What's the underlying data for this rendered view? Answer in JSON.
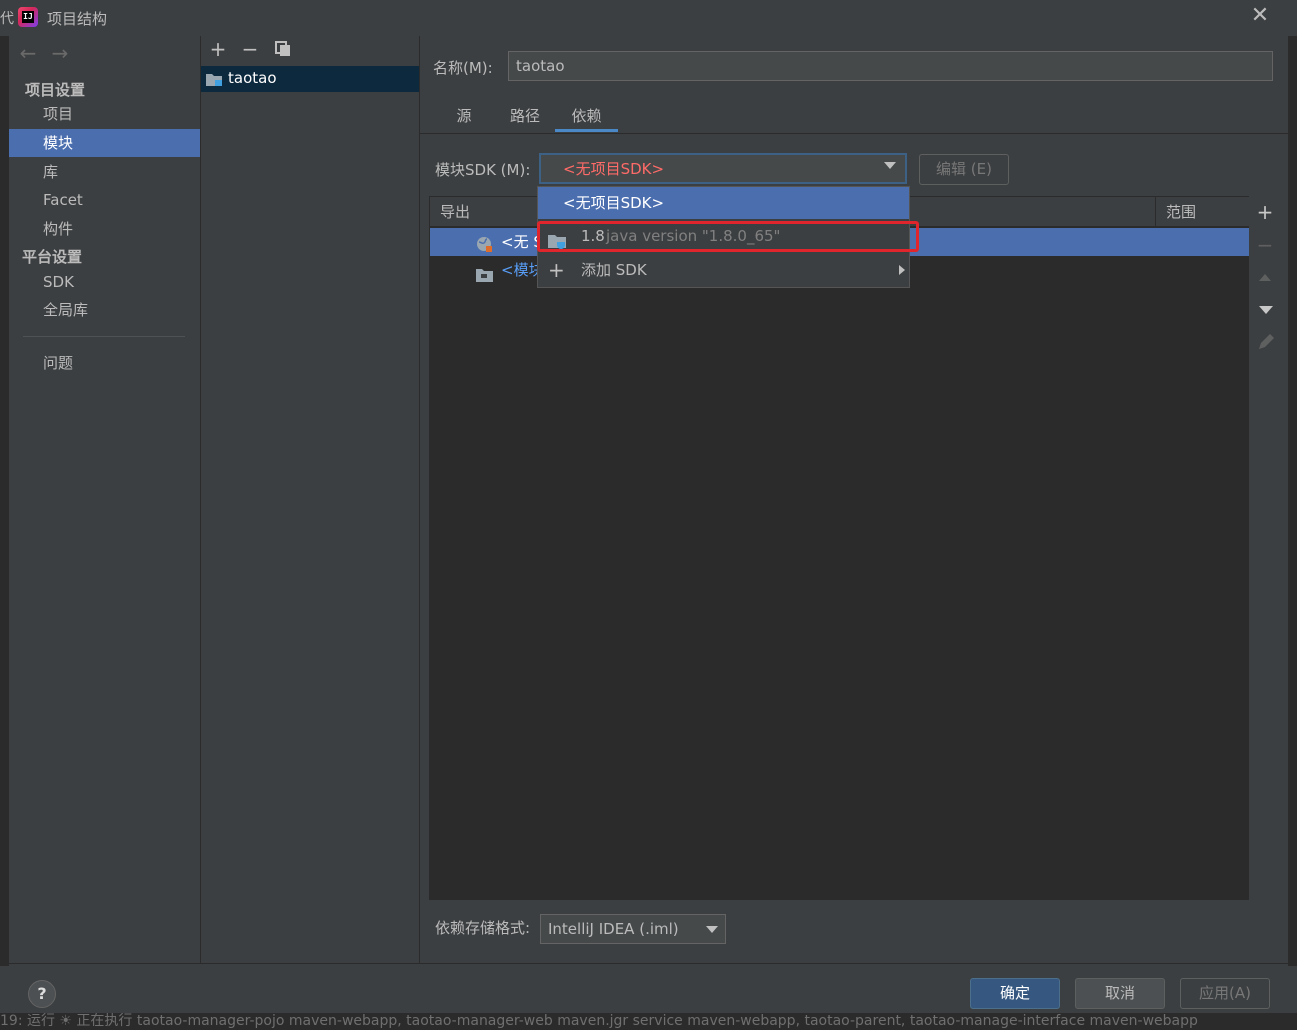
{
  "window": {
    "title": "项目结构",
    "left_edge_char": "代"
  },
  "sidebar": {
    "section_project": "项目设置",
    "section_platform": "平台设置",
    "items": [
      {
        "label": "项目"
      },
      {
        "label": "模块"
      },
      {
        "label": "库"
      },
      {
        "label": "Facet"
      },
      {
        "label": "构件"
      },
      {
        "label": "SDK"
      },
      {
        "label": "全局库"
      },
      {
        "label": "问题"
      }
    ]
  },
  "module_list": {
    "items": [
      {
        "label": "taotao"
      }
    ]
  },
  "module": {
    "name_label": "名称(M):",
    "name_value": "taotao",
    "tabs": [
      {
        "label": "源"
      },
      {
        "label": "路径"
      },
      {
        "label": "依赖"
      }
    ],
    "sdk_label": "模块SDK (M):",
    "sdk_value": "<无项目SDK>",
    "edit_button": "编辑 (E)",
    "table": {
      "col_export": "导出",
      "col_scope": "范围",
      "rows": [
        {
          "label": "<无 S"
        },
        {
          "label": "<模块"
        }
      ]
    },
    "storage_label": "依赖存储格式:",
    "storage_value": "IntelliJ IDEA (.iml)"
  },
  "sdk_dropdown": {
    "items": [
      {
        "label": "<无项目SDK>"
      },
      {
        "version": "1.8",
        "desc": "java version \"1.8.0_65\""
      },
      {
        "label": "添加 SDK"
      }
    ]
  },
  "footer": {
    "help": "?",
    "ok": "确定",
    "cancel": "取消",
    "apply": "应用(A)"
  },
  "background_text": "19: 运行   ☀ 正在执行 taotao-manager-pojo maven-webapp, taotao-manager-web maven.jgr service maven-webapp, taotao-parent, taotao-manage-interface maven-webapp",
  "colors": {
    "accent": "#4b6eaf",
    "error_text": "#ff6b68",
    "highlight_box": "#e0262c"
  }
}
